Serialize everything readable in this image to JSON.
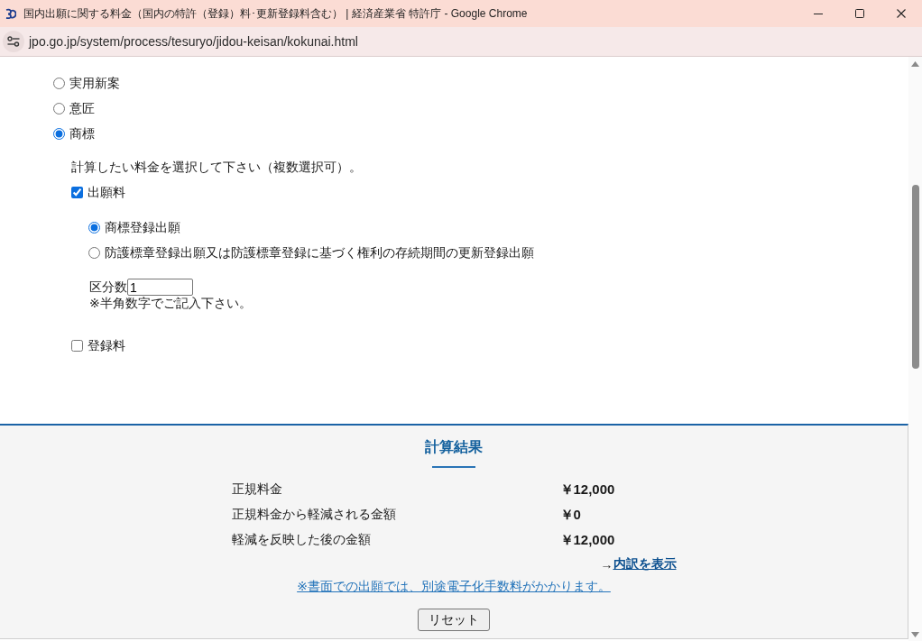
{
  "window": {
    "title": "国内出願に関する料金（国内の特許（登録）料･更新登録料含む） | 経済産業省 特許庁 - Google Chrome",
    "url": "jpo.go.jp/system/process/tesuryo/jidou-keisan/kokunai.html"
  },
  "right_types": [
    {
      "label": "実用新案",
      "selected": false
    },
    {
      "label": "意匠",
      "selected": false
    },
    {
      "label": "商標",
      "selected": true
    }
  ],
  "fee_prompt": "計算したい料金を選択して下さい（複数選択可）。",
  "fees": [
    {
      "label": "出願料",
      "checked": true,
      "application_types": [
        {
          "label": "商標登録出願",
          "selected": true
        },
        {
          "label": "防護標章登録出願又は防護標章登録に基づく権利の存続期間の更新登録出願",
          "selected": false
        }
      ],
      "class_count": {
        "label": "区分数",
        "value": "1",
        "note": "※半角数字でご記入下さい。"
      }
    },
    {
      "label": "登録料",
      "checked": false
    }
  ],
  "results": {
    "title": "計算結果",
    "rows": [
      {
        "label": "正規料金",
        "amount": "￥12,000"
      },
      {
        "label": "正規料金から軽減される金額",
        "amount": "￥0"
      },
      {
        "label": "軽減を反映した後の金額",
        "amount": "￥12,000"
      }
    ],
    "breakdown_arrow": "→",
    "breakdown_link": "内訳を表示",
    "note_link": "※書面での出願では、別途電子化手数料がかかります。",
    "reset_button": "リセット"
  }
}
